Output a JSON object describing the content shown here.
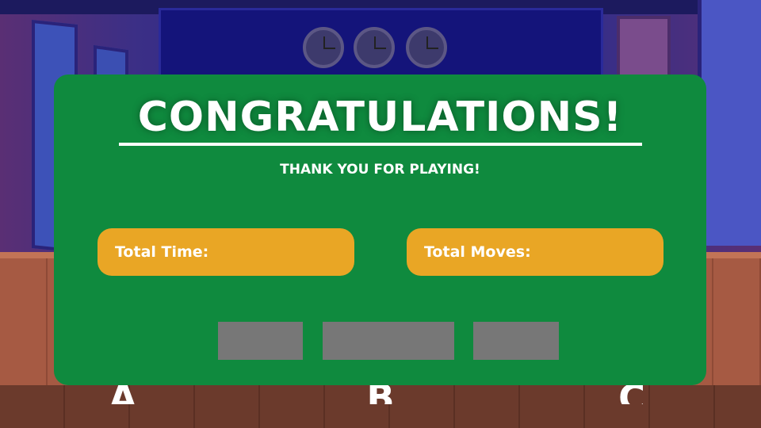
{
  "modal": {
    "title": "CONGRATULATIONS!",
    "subtitle": "THANK YOU FOR PLAYING!",
    "stats": {
      "time_label": "Total Time:",
      "time_value": "",
      "moves_label": "Total Moves:",
      "moves_value": ""
    },
    "buttons": [
      "",
      "",
      ""
    ]
  },
  "background": {
    "tiles": [
      "A",
      "B",
      "C"
    ]
  },
  "colors": {
    "modal": "#0f8a3e",
    "stat_box": "#e9a625",
    "button": "#777777",
    "text": "#ffffff"
  }
}
